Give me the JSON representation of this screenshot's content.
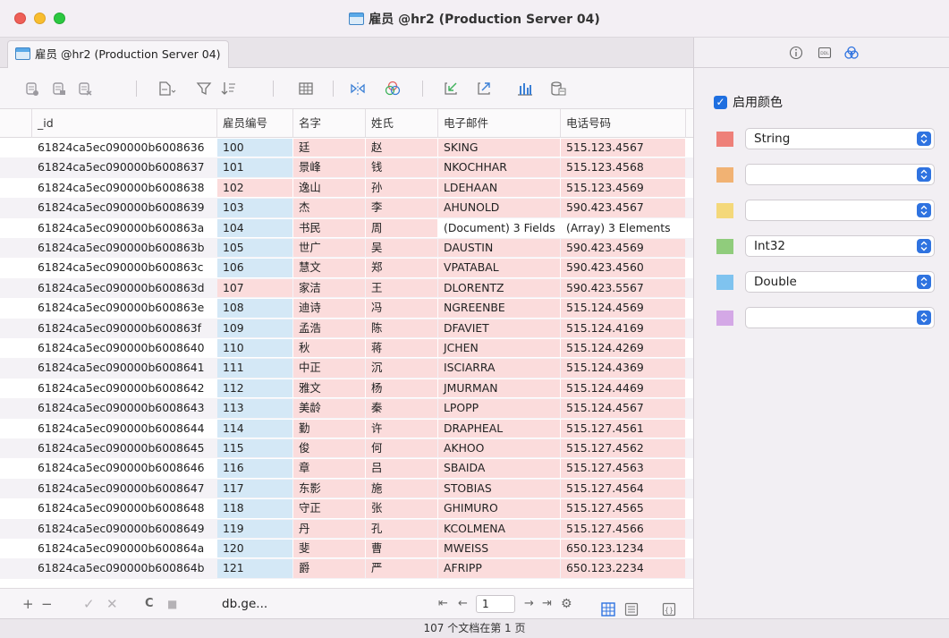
{
  "window": {
    "title": "雇员 @hr2 (Production Server 04)"
  },
  "tab": {
    "label": "雇员 @hr2 (Production Server 04)"
  },
  "columns": [
    "_id",
    "雇员编号",
    "名字",
    "姓氏",
    "电子邮件",
    "电话号码"
  ],
  "rows": [
    {
      "id": "61824ca5ec090000b6008636",
      "empno": "100",
      "first": "廷",
      "last": "赵",
      "email": "SKING",
      "phone": "515.123.4567"
    },
    {
      "id": "61824ca5ec090000b6008637",
      "empno": "101",
      "first": "景峰",
      "last": "钱",
      "email": "NKOCHHAR",
      "phone": "515.123.4568"
    },
    {
      "id": "61824ca5ec090000b6008638",
      "empno": "102",
      "first": "逸山",
      "last": "孙",
      "email": "LDEHAAN",
      "phone": "515.123.4569"
    },
    {
      "id": "61824ca5ec090000b6008639",
      "empno": "103",
      "first": "杰",
      "last": "李",
      "email": "AHUNOLD",
      "phone": "590.423.4567"
    },
    {
      "id": "61824ca5ec090000b600863a",
      "empno": "104",
      "first": "书民",
      "last": "周",
      "email": "(Document) 3 Fields",
      "phone": "(Array) 3 Elements"
    },
    {
      "id": "61824ca5ec090000b600863b",
      "empno": "105",
      "first": "世广",
      "last": "吴",
      "email": "DAUSTIN",
      "phone": "590.423.4569"
    },
    {
      "id": "61824ca5ec090000b600863c",
      "empno": "106",
      "first": "慧文",
      "last": "郑",
      "email": "VPATABAL",
      "phone": "590.423.4560"
    },
    {
      "id": "61824ca5ec090000b600863d",
      "empno": "107",
      "first": "家洁",
      "last": "王",
      "email": "DLORENTZ",
      "phone": "590.423.5567"
    },
    {
      "id": "61824ca5ec090000b600863e",
      "empno": "108",
      "first": "迪诗",
      "last": "冯",
      "email": "NGREENBE",
      "phone": "515.124.4569"
    },
    {
      "id": "61824ca5ec090000b600863f",
      "empno": "109",
      "first": "孟浩",
      "last": "陈",
      "email": "DFAVIET",
      "phone": "515.124.4169"
    },
    {
      "id": "61824ca5ec090000b6008640",
      "empno": "110",
      "first": "秋",
      "last": "蒋",
      "email": "JCHEN",
      "phone": "515.124.4269"
    },
    {
      "id": "61824ca5ec090000b6008641",
      "empno": "111",
      "first": "中正",
      "last": "沉",
      "email": "ISCIARRA",
      "phone": "515.124.4369"
    },
    {
      "id": "61824ca5ec090000b6008642",
      "empno": "112",
      "first": "雅文",
      "last": "杨",
      "email": "JMURMAN",
      "phone": "515.124.4469"
    },
    {
      "id": "61824ca5ec090000b6008643",
      "empno": "113",
      "first": "美龄",
      "last": "秦",
      "email": "LPOPP",
      "phone": "515.124.4567"
    },
    {
      "id": "61824ca5ec090000b6008644",
      "empno": "114",
      "first": "勤",
      "last": "许",
      "email": "DRAPHEAL",
      "phone": "515.127.4561"
    },
    {
      "id": "61824ca5ec090000b6008645",
      "empno": "115",
      "first": "俊",
      "last": "何",
      "email": "AKHOO",
      "phone": "515.127.4562"
    },
    {
      "id": "61824ca5ec090000b6008646",
      "empno": "116",
      "first": "章",
      "last": "吕",
      "email": "SBAIDA",
      "phone": "515.127.4563"
    },
    {
      "id": "61824ca5ec090000b6008647",
      "empno": "117",
      "first": "东影",
      "last": "施",
      "email": "STOBIAS",
      "phone": "515.127.4564"
    },
    {
      "id": "61824ca5ec090000b6008648",
      "empno": "118",
      "first": "守正",
      "last": "张",
      "email": "GHIMURO",
      "phone": "515.127.4565"
    },
    {
      "id": "61824ca5ec090000b6008649",
      "empno": "119",
      "first": "丹",
      "last": "孔",
      "email": "KCOLMENA",
      "phone": "515.127.4566"
    },
    {
      "id": "61824ca5ec090000b600864a",
      "empno": "120",
      "first": "斐",
      "last": "曹",
      "email": "MWEISS",
      "phone": "650.123.1234"
    },
    {
      "id": "61824ca5ec090000b600864b",
      "empno": "121",
      "first": "爵",
      "last": "严",
      "email": "AFRIPP",
      "phone": "650.123.2234"
    }
  ],
  "bottom": {
    "add": "+",
    "remove": "−",
    "apply": "✓",
    "discard": "✕",
    "refresh": "C",
    "stop": "■",
    "query": "db.ge...",
    "first_page": "⇤",
    "prev_page": "←",
    "page": "1",
    "next_page": "→",
    "last_page": "⇥",
    "settings": "⚙"
  },
  "status": "107 个文档在第 1 页",
  "panel": {
    "enable_label": "启用颜色",
    "enable_checked": "✓",
    "color_rules": [
      {
        "color": "#ee8079",
        "type": "String"
      },
      {
        "color": "#f1b273",
        "type": ""
      },
      {
        "color": "#f4d87a",
        "type": ""
      },
      {
        "color": "#90cc7c",
        "type": "Int32"
      },
      {
        "color": "#7fc3ef",
        "type": "Double"
      },
      {
        "color": "#d4a8e6",
        "type": ""
      }
    ]
  }
}
